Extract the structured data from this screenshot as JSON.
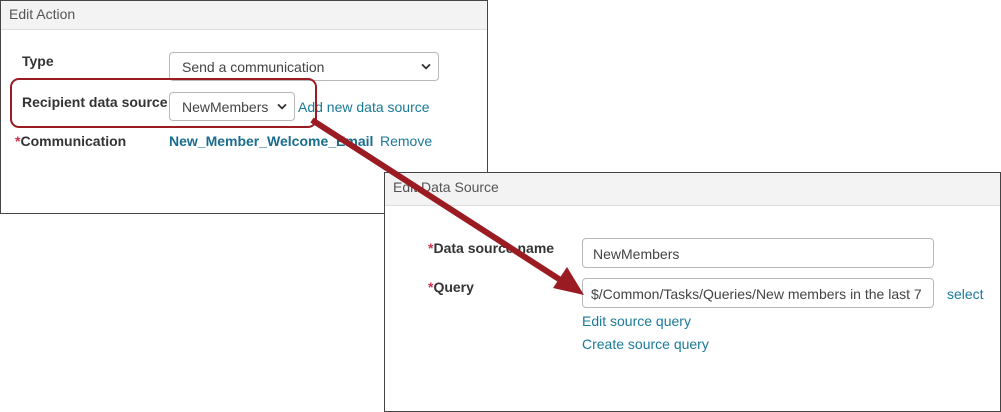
{
  "edit_action": {
    "title": "Edit Action",
    "type_label": "Type",
    "type_value": "Send a communication",
    "recipient_label": "Recipient data source",
    "recipient_value": "NewMembers",
    "add_new_link": "Add new data source",
    "communication_label": "Communication",
    "communication_value": "New_Member_Welcome_Email",
    "remove_link": "Remove"
  },
  "edit_data_source": {
    "title": "Edit Data Source",
    "name_label": "Data source name",
    "name_value": "NewMembers",
    "query_label": "Query",
    "query_value": "$/Common/Tasks/Queries/New members in the last 7",
    "select_link": "select",
    "edit_query_link": "Edit source query",
    "create_query_link": "Create source query"
  },
  "required_marker": "*",
  "colors": {
    "accent_link": "#1a7a9a",
    "callout_red": "#9b1b22",
    "required_red": "#c7354d"
  },
  "icons": {
    "dropdown": "chevron-down-icon"
  }
}
